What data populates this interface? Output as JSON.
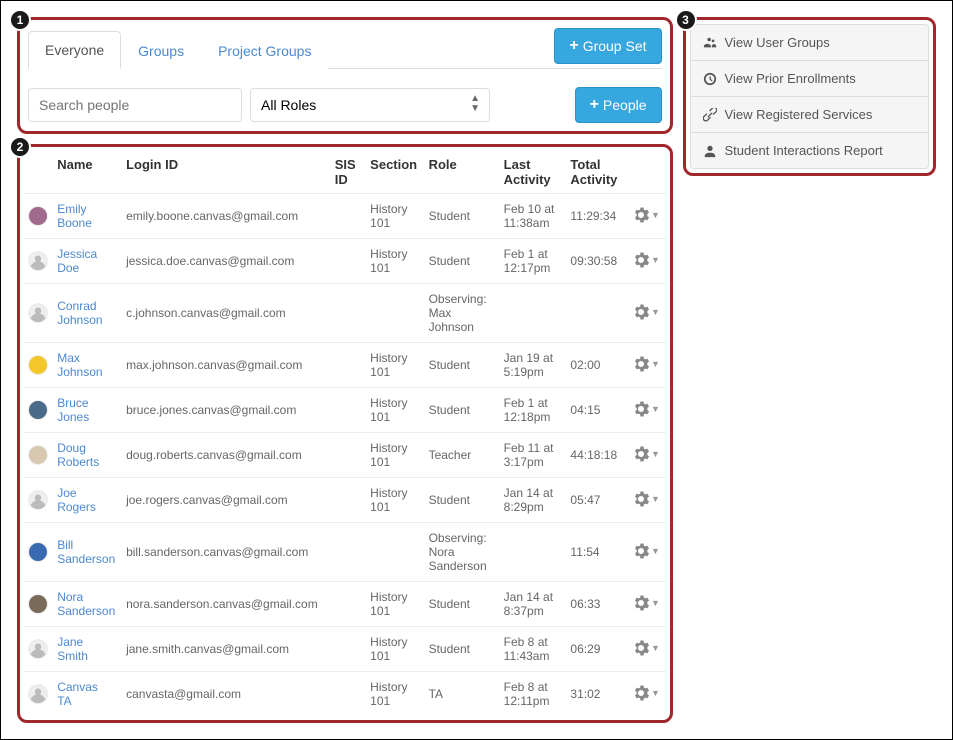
{
  "callouts": {
    "one": "1",
    "two": "2",
    "three": "3"
  },
  "tabs": {
    "everyone": "Everyone",
    "groups": "Groups",
    "project_groups": "Project Groups"
  },
  "buttons": {
    "group_set": "Group Set",
    "people": "People"
  },
  "filters": {
    "search_placeholder": "Search people",
    "role_selected": "All Roles"
  },
  "table": {
    "headers": {
      "name": "Name",
      "login": "Login ID",
      "sis1": "SIS",
      "sis2": "ID",
      "section": "Section",
      "role": "Role",
      "last1": "Last",
      "last2": "Activity",
      "total1": "Total",
      "total2": "Activity"
    },
    "rows": [
      {
        "avatar": "color-1",
        "name": "Emily Boone",
        "login": "emily.boone.canvas@gmail.com",
        "sis": "",
        "section": "History 101",
        "role": "Student",
        "last": "Feb 10 at 11:38am",
        "total": "11:29:34"
      },
      {
        "avatar": "default",
        "name": "Jessica Doe",
        "login": "jessica.doe.canvas@gmail.com",
        "sis": "",
        "section": "History 101",
        "role": "Student",
        "last": "Feb 1 at 12:17pm",
        "total": "09:30:58"
      },
      {
        "avatar": "default",
        "name": "Conrad Johnson",
        "login": "c.johnson.canvas@gmail.com",
        "sis": "",
        "section": "",
        "role": "Observing: Max Johnson",
        "last": "",
        "total": ""
      },
      {
        "avatar": "color-2",
        "name": "Max Johnson",
        "login": "max.johnson.canvas@gmail.com",
        "sis": "",
        "section": "History 101",
        "role": "Student",
        "last": "Jan 19 at 5:19pm",
        "total": "02:00"
      },
      {
        "avatar": "color-3",
        "name": "Bruce Jones",
        "login": "bruce.jones.canvas@gmail.com",
        "sis": "",
        "section": "History 101",
        "role": "Student",
        "last": "Feb 1 at 12:18pm",
        "total": "04:15"
      },
      {
        "avatar": "color-4",
        "name": "Doug Roberts",
        "login": "doug.roberts.canvas@gmail.com",
        "sis": "",
        "section": "History 101",
        "role": "Teacher",
        "last": "Feb 11 at 3:17pm",
        "total": "44:18:18"
      },
      {
        "avatar": "default",
        "name": "Joe Rogers",
        "login": "joe.rogers.canvas@gmail.com",
        "sis": "",
        "section": "History 101",
        "role": "Student",
        "last": "Jan 14 at 8:29pm",
        "total": "05:47"
      },
      {
        "avatar": "color-5",
        "name": "Bill Sanderson",
        "login": "bill.sanderson.canvas@gmail.com",
        "sis": "",
        "section": "",
        "role": "Observing: Nora Sanderson",
        "last": "",
        "total": "11:54"
      },
      {
        "avatar": "color-6",
        "name": "Nora Sanderson",
        "login": "nora.sanderson.canvas@gmail.com",
        "sis": "",
        "section": "History 101",
        "role": "Student",
        "last": "Jan 14 at 8:37pm",
        "total": "06:33"
      },
      {
        "avatar": "default",
        "name": "Jane Smith",
        "login": "jane.smith.canvas@gmail.com",
        "sis": "",
        "section": "History 101",
        "role": "Student",
        "last": "Feb 8 at 11:43am",
        "total": "06:29"
      },
      {
        "avatar": "default",
        "name": "Canvas TA",
        "login": "canvasta@gmail.com",
        "sis": "",
        "section": "History 101",
        "role": "TA",
        "last": "Feb 8 at 12:11pm",
        "total": "31:02"
      }
    ]
  },
  "sidebar": {
    "items": [
      "View User Groups",
      "View Prior Enrollments",
      "View Registered Services",
      "Student Interactions Report"
    ]
  },
  "avatar_colors": {
    "color-1": "#a06a8a",
    "color-2": "#f3c62a",
    "color-3": "#4a6a8a",
    "color-4": "#d8c8b0",
    "color-5": "#3a6ab0",
    "color-6": "#7a6a5a"
  }
}
